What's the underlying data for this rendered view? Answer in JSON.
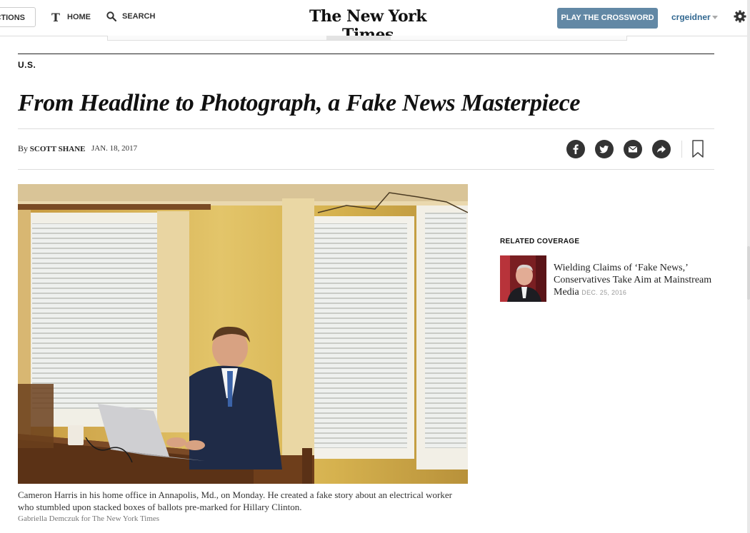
{
  "nav": {
    "sections_label": "SECTIONS",
    "sections_visible": "CTIONS",
    "home_label": "HOME",
    "search_label": "SEARCH",
    "logo_text": "The New York Times",
    "crossword_label": "PLAY THE CROSSWORD",
    "username": "crgeidner"
  },
  "article": {
    "section": "U.S.",
    "headline": "From Headline to Photograph, a Fake News Masterpiece",
    "byline_prefix": "By",
    "author": "SCOTT SHANE",
    "date": "JAN. 18, 2017",
    "caption": "Cameron Harris in his home office in Annapolis, Md., on Monday. He created a fake story about an electrical worker who stumbled upon stacked boxes of ballots pre-marked for Hillary Clinton.",
    "photo_credit": "Gabriella Demczuk for The New York Times"
  },
  "share": {
    "icons": [
      "facebook-icon",
      "twitter-icon",
      "email-icon",
      "share-icon",
      "bookmark-icon"
    ]
  },
  "related": {
    "label": "RELATED COVERAGE",
    "items": [
      {
        "title": "Wielding Claims of ‘Fake News,’ Conservatives Take Aim at Mainstream Media",
        "date": "DEC. 25, 2016"
      }
    ]
  },
  "colors": {
    "crossword_button": "#6288a5",
    "username": "#326891",
    "share_icon_bg": "#333333"
  }
}
